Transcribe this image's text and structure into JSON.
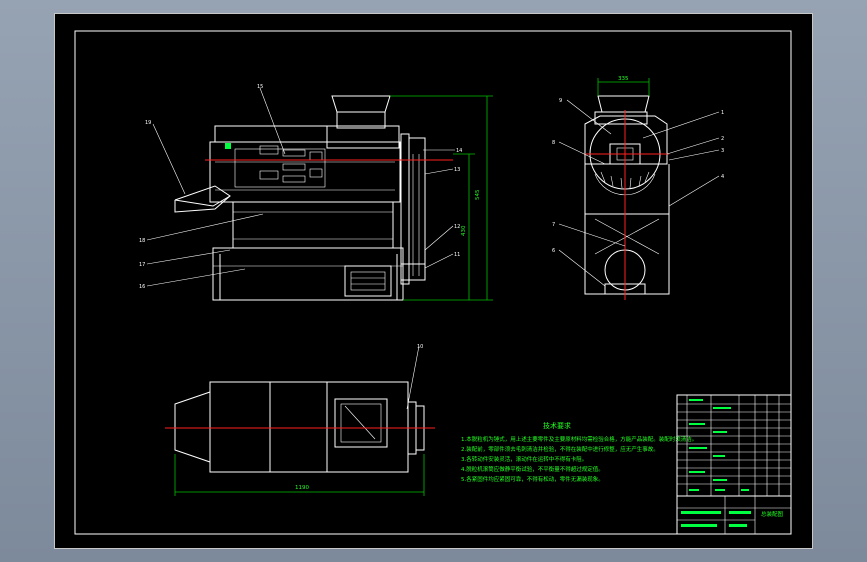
{
  "notes": {
    "heading": "技术要求",
    "items": [
      "1.本脱粒机为锤式，用上述主要零件及主要原材料均需检验合格，方能产品装配。装配时须清洁。",
      "2.装配前，零部件须去毛刺清洁并检验，不得在装配中进行修整，应无产生事故。",
      "3.各转动件安装灵活，滚动件在运转中不得有卡阻。",
      "4.脱粒机滚筒应做静平衡试验，不平衡量不得超过规定值。",
      "5.各紧固件均应紧固可靠，不得有松动，零件无漏装现象。"
    ]
  },
  "dimensions": {
    "front_height": "545",
    "front_lower": "430",
    "side_width": "335",
    "top_length": "1190"
  },
  "balloons": {
    "front_left": [
      "19",
      "18",
      "17",
      "16"
    ],
    "front_top": "15",
    "front_right": [
      "14",
      "13",
      "12",
      "11"
    ],
    "side_left": [
      "9",
      "8",
      "7",
      "6",
      "5"
    ],
    "side_right": [
      "1",
      "2",
      "3",
      "4"
    ],
    "top_view": "10"
  },
  "title_block": {
    "drawing_no": "总装配图"
  },
  "colors": {
    "canvas": "#000000",
    "line": "#ffffff",
    "dimension": "#00c000",
    "centerline": "#ff2020",
    "text": "#22ff22",
    "backdrop": "#8d9aab"
  }
}
